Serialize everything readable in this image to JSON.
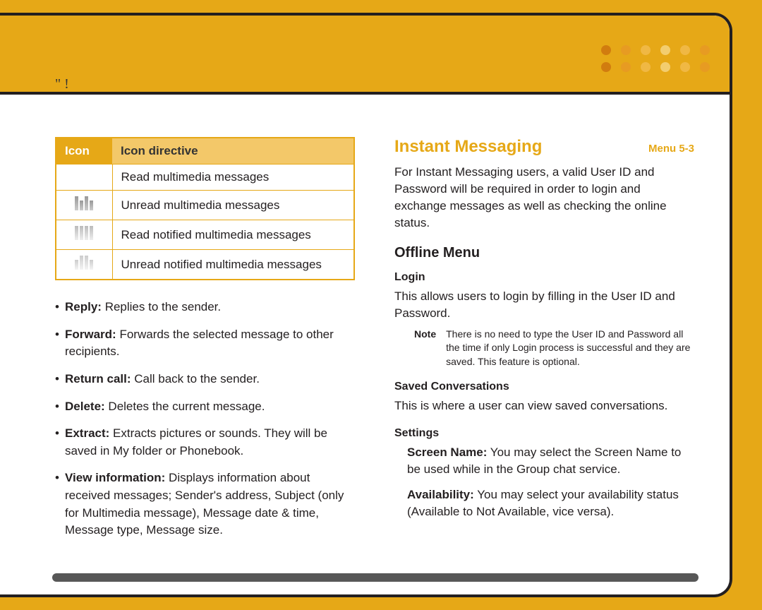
{
  "header": {
    "quote_marks": "\"   !"
  },
  "left": {
    "table": {
      "head_icon": "Icon",
      "head_directive": "Icon directive",
      "rows": [
        {
          "directive": "Read multimedia messages"
        },
        {
          "directive": "Unread multimedia messages"
        },
        {
          "directive": "Read notified multimedia messages"
        },
        {
          "directive": "Unread notified multimedia messages"
        }
      ]
    },
    "bullets": [
      {
        "term": "Reply:",
        "desc": " Replies to the sender."
      },
      {
        "term": "Forward:",
        "desc": " Forwards the selected message to other recipients."
      },
      {
        "term": "Return call:",
        "desc": " Call back to the sender."
      },
      {
        "term": "Delete:",
        "desc": " Deletes the current message."
      },
      {
        "term": "Extract:",
        "desc": " Extracts pictures or sounds. They will be saved in My folder or Phonebook."
      },
      {
        "term": "View information:",
        "desc": " Displays information about received messages; Sender's address, Subject (only for Multimedia message), Message date & time, Message type, Message size."
      }
    ]
  },
  "right": {
    "im_title": "Instant Messaging",
    "menu_ref": "Menu 5-3",
    "im_para": "For Instant Messaging users, a valid User ID and Password will be required in order to login and exchange messages as well as checking the online status.",
    "offline_title": "Offline Menu",
    "login_head": "Login",
    "login_para": "This allows users to login by filling in the User ID and Password.",
    "note_label": "Note",
    "note_text": "There is no need to type the User ID and Password all the time if only Login process is successful and they are saved. This feature is optional.",
    "saved_head": "Saved Conversations",
    "saved_para": "This is where a user can view saved conversations.",
    "settings_head": "Settings",
    "settings": [
      {
        "term": "Screen Name:",
        "desc": " You may select the Screen Name to be used while in the Group chat service."
      },
      {
        "term": "Availability:",
        "desc": " You may select your availability status (Available to Not Available, vice versa)."
      }
    ]
  }
}
